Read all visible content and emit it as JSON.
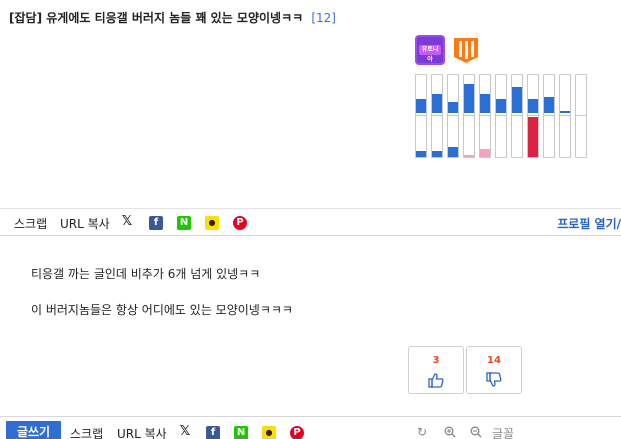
{
  "post": {
    "category": "[잡담]",
    "title": "유게에도 티응갤 버러지 놈들 꽤 있는 모양이넹ㅋㅋ",
    "comment_count": "[12]"
  },
  "badges": [
    {
      "name": "purple-badge",
      "text": "유토니아",
      "color": "#7c3bd6"
    },
    {
      "name": "orange-badge",
      "color": "#ff7a12"
    }
  ],
  "activity_bars": [
    {
      "top": 0.38,
      "top_color": "#2a6fd6",
      "bottom": 0.16,
      "bottom_color": "#2a6fd6"
    },
    {
      "top": 0.5,
      "top_color": "#2a6fd6",
      "bottom": 0.16,
      "bottom_color": "#2a6fd6"
    },
    {
      "top": 0.28,
      "top_color": "#2a6fd6",
      "bottom": 0.26,
      "bottom_color": "#2a6fd6"
    },
    {
      "top": 0.75,
      "top_color": "#2a6fd6",
      "bottom": 0.06,
      "bottom_color": "#f2a4c2"
    },
    {
      "top": 0.5,
      "top_color": "#2a6fd6",
      "bottom": 0.2,
      "bottom_color": "#f2a4c2"
    },
    {
      "top": 0.36,
      "top_color": "#2a6fd6",
      "bottom": 0.0,
      "bottom_color": "#2a6fd6"
    },
    {
      "top": 0.68,
      "top_color": "#2a6fd6",
      "bottom": 0.0,
      "bottom_color": "#2a6fd6"
    },
    {
      "top": 0.36,
      "top_color": "#2a6fd6",
      "bottom": 1.0,
      "bottom_color": "#dd2244"
    },
    {
      "top": 0.42,
      "top_color": "#2a6fd6",
      "bottom": 0.0,
      "bottom_color": "#2a6fd6"
    },
    {
      "top": 0.04,
      "top_color": "#2a6fd6",
      "bottom": 0.0,
      "bottom_color": "#2a6fd6"
    },
    {
      "top": 0.0,
      "top_color": "#2a6fd6",
      "bottom": 0.0,
      "bottom_color": "#2a6fd6"
    }
  ],
  "toolbar": {
    "scrap": "스크랩",
    "url_copy": "URL 복사",
    "profile_link": "프로필 열기/"
  },
  "share_icons": [
    {
      "name": "x-share-icon",
      "glyph": "𝕏",
      "color": "#222222"
    },
    {
      "name": "facebook-share-icon",
      "glyph": "f",
      "color": "#3b5998"
    },
    {
      "name": "naver-share-icon",
      "glyph": "N",
      "color": "#1ec800"
    },
    {
      "name": "kakao-share-icon",
      "glyph": "●",
      "color": "#f9e000"
    },
    {
      "name": "pinterest-share-icon",
      "glyph": "P",
      "color": "#e60023"
    }
  ],
  "content": {
    "line1": "티응갤 까는 글인데 비추가 6개 넘게 있넹ㅋㅋ",
    "line2": "이 버러지놈들은 항상 어디에도 있는 모양이넹ㅋㅋㅋ"
  },
  "votes": {
    "up": "3",
    "down": "14"
  },
  "bottom_toolbar": {
    "write": "글쓰기",
    "scrap": "스크랩",
    "url_copy": "URL 복사",
    "font": "글꼴"
  }
}
